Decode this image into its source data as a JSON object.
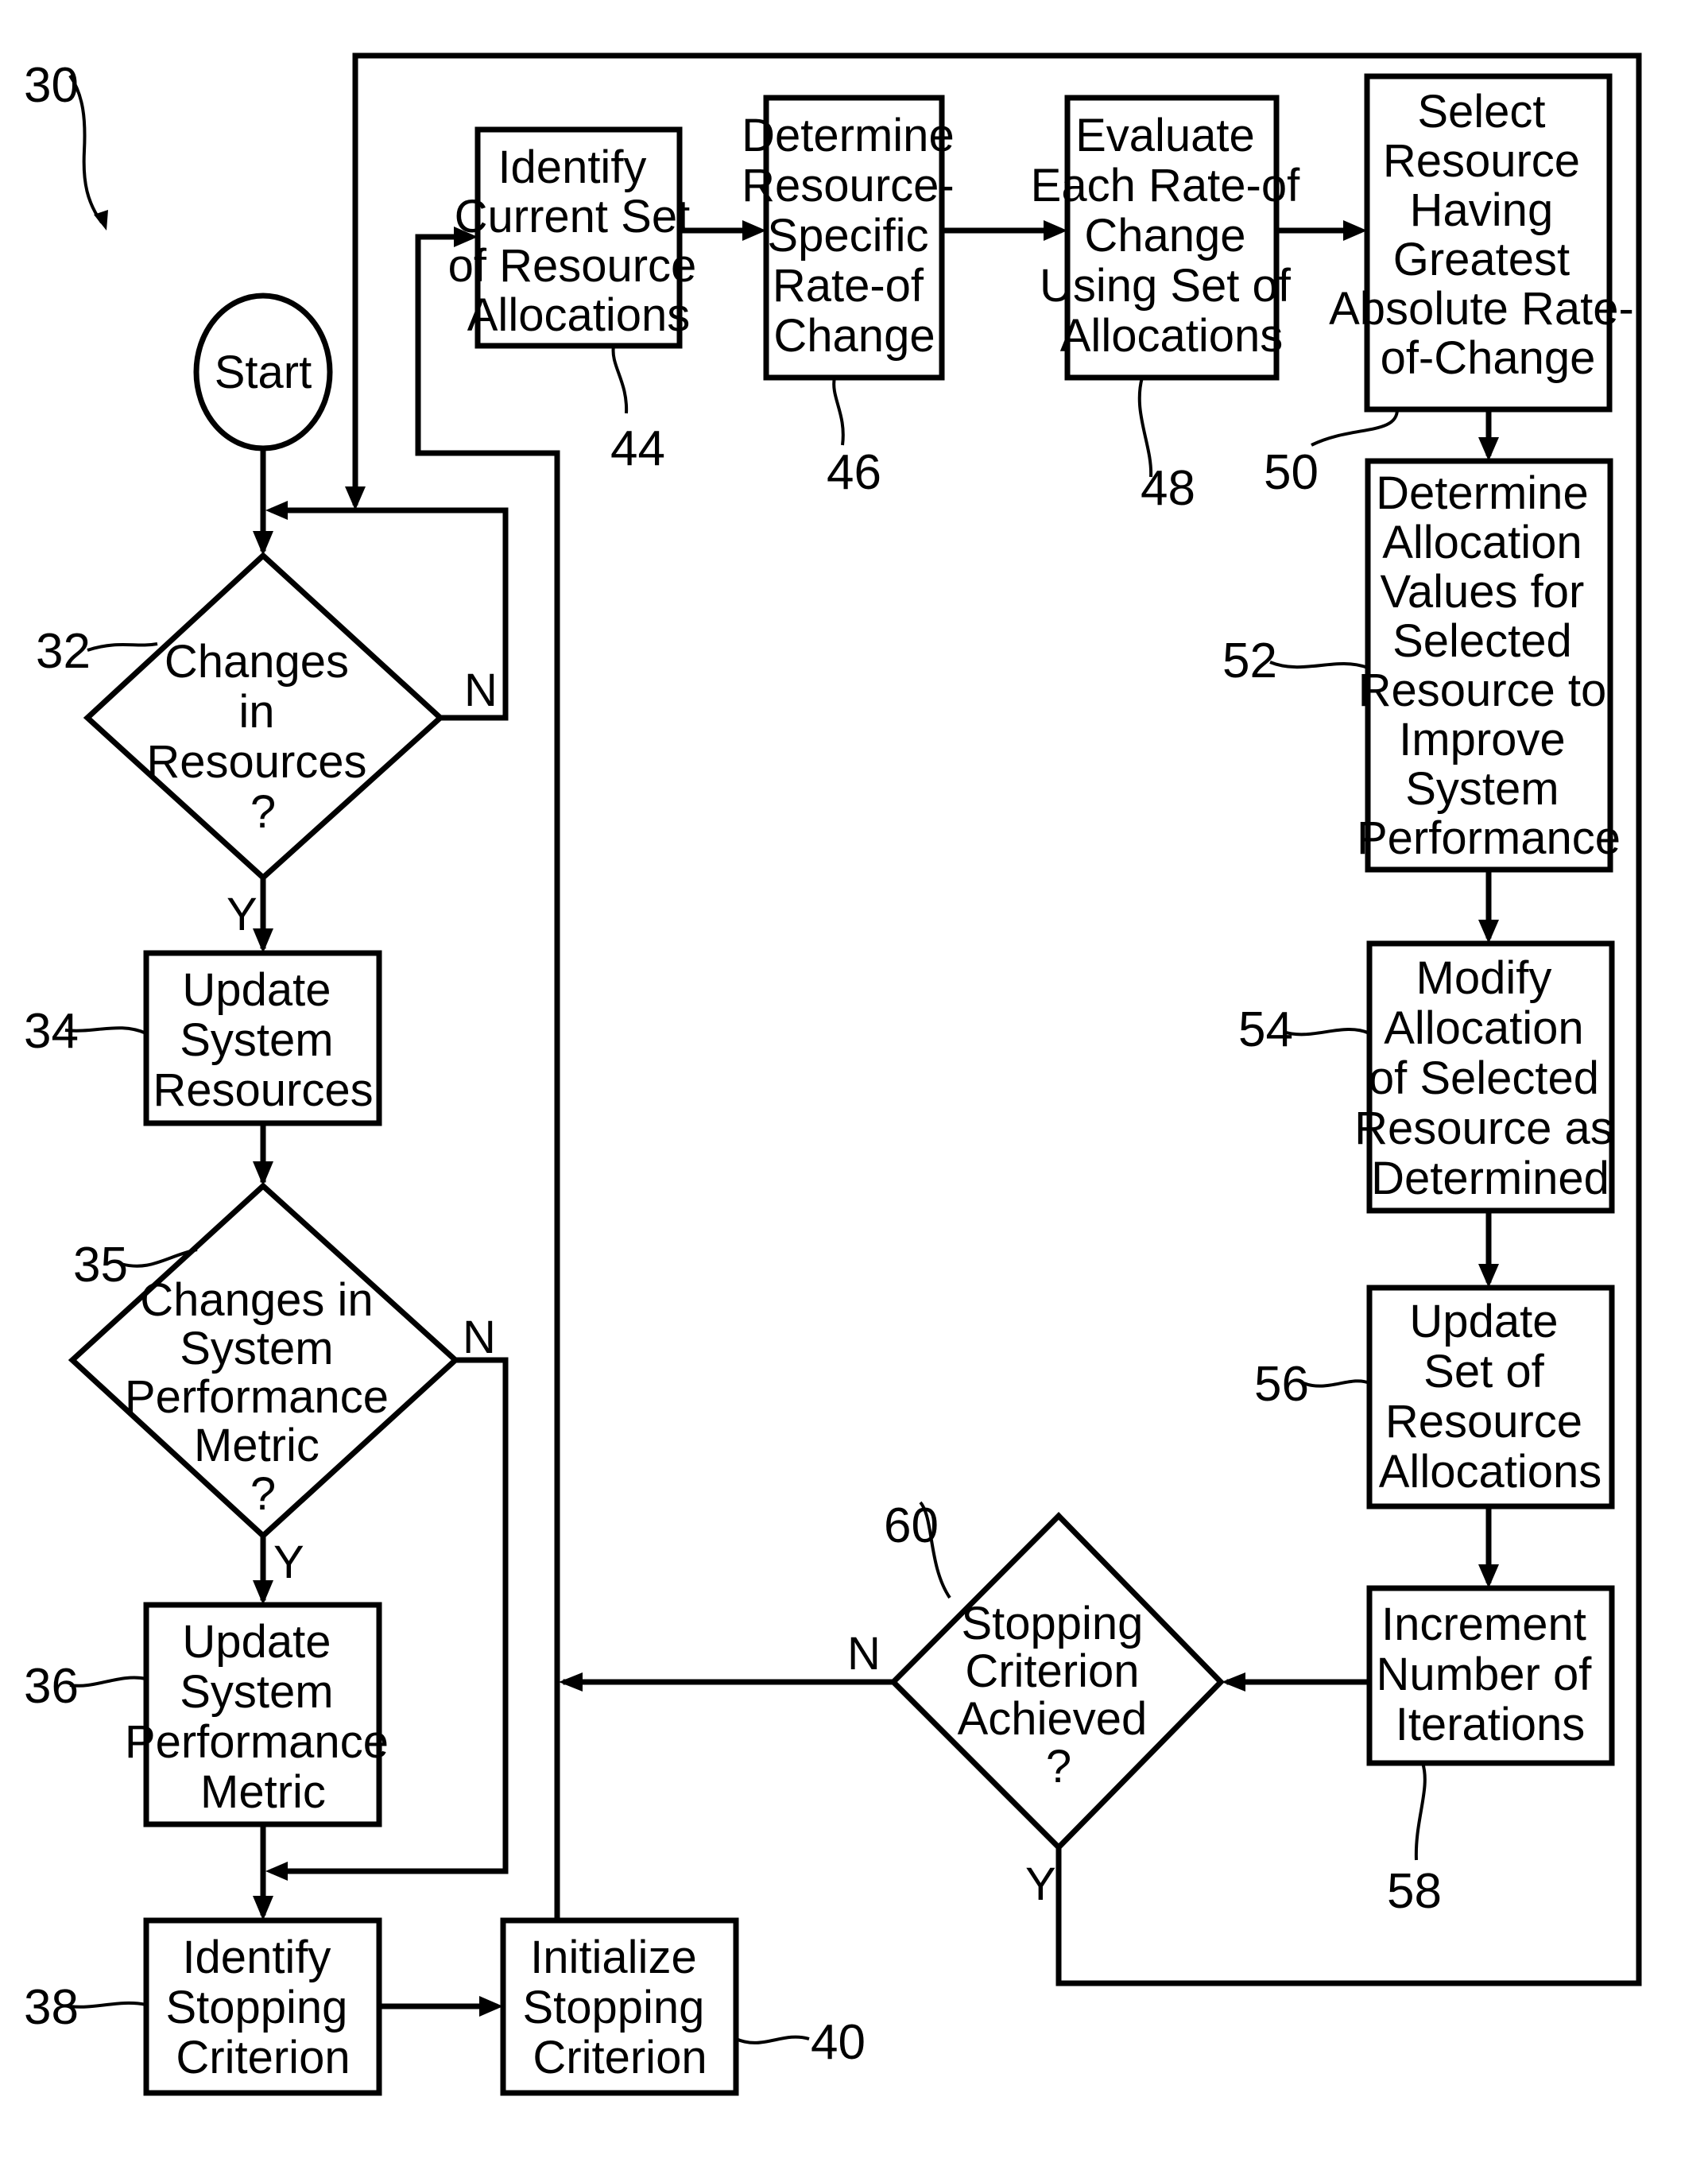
{
  "figure": {
    "reference": "30",
    "start_label": "Start"
  },
  "nodes": {
    "n32": {
      "ref": "32",
      "type": "decision",
      "lines": [
        "Changes",
        "in",
        "Resources",
        "?"
      ],
      "yes": "Y",
      "no": "N"
    },
    "n34": {
      "ref": "34",
      "type": "process",
      "lines": [
        "Update",
        "System",
        "Resources"
      ]
    },
    "n35": {
      "ref": "35",
      "type": "decision",
      "lines": [
        "Changes in",
        "System",
        "Performance",
        "Metric",
        "?"
      ],
      "yes": "Y",
      "no": "N"
    },
    "n36": {
      "ref": "36",
      "type": "process",
      "lines": [
        "Update",
        "System",
        "Performance",
        "Metric"
      ]
    },
    "n38": {
      "ref": "38",
      "type": "process",
      "lines": [
        "Identify",
        "Stopping",
        "Criterion"
      ]
    },
    "n40": {
      "ref": "40",
      "type": "process",
      "lines": [
        "Initialize",
        "Stopping",
        "Criterion"
      ]
    },
    "n44": {
      "ref": "44",
      "type": "process",
      "lines": [
        "Identify",
        "Current Set",
        "of Resource",
        "Allocations"
      ]
    },
    "n46": {
      "ref": "46",
      "type": "process",
      "lines": [
        "Determine",
        "Resource-",
        "Specific",
        "Rate-of",
        "Change"
      ]
    },
    "n48": {
      "ref": "48",
      "type": "process",
      "lines": [
        "Evaluate",
        "Each Rate-of",
        "Change",
        "Using Set of",
        "Allocations"
      ]
    },
    "n50": {
      "ref": "50",
      "type": "process",
      "lines": [
        "Select",
        "Resource",
        "Having",
        "Greatest",
        "Absolute Rate-",
        "of-Change"
      ]
    },
    "n52": {
      "ref": "52",
      "type": "process",
      "lines": [
        "Determine",
        "Allocation",
        "Values for",
        "Selected",
        "Resource to",
        "Improve",
        "System",
        "Performance"
      ]
    },
    "n54": {
      "ref": "54",
      "type": "process",
      "lines": [
        "Modify",
        "Allocation",
        "of Selected",
        "Resource as",
        "Determined"
      ]
    },
    "n56": {
      "ref": "56",
      "type": "process",
      "lines": [
        "Update",
        "Set of",
        "Resource",
        "Allocations"
      ]
    },
    "n58": {
      "ref": "58",
      "type": "process",
      "lines": [
        "Increment",
        "Number of",
        "Iterations"
      ]
    },
    "n60": {
      "ref": "60",
      "type": "decision",
      "lines": [
        "Stopping",
        "Criterion",
        "Achieved",
        "?"
      ],
      "yes": "Y",
      "no": "N"
    }
  }
}
